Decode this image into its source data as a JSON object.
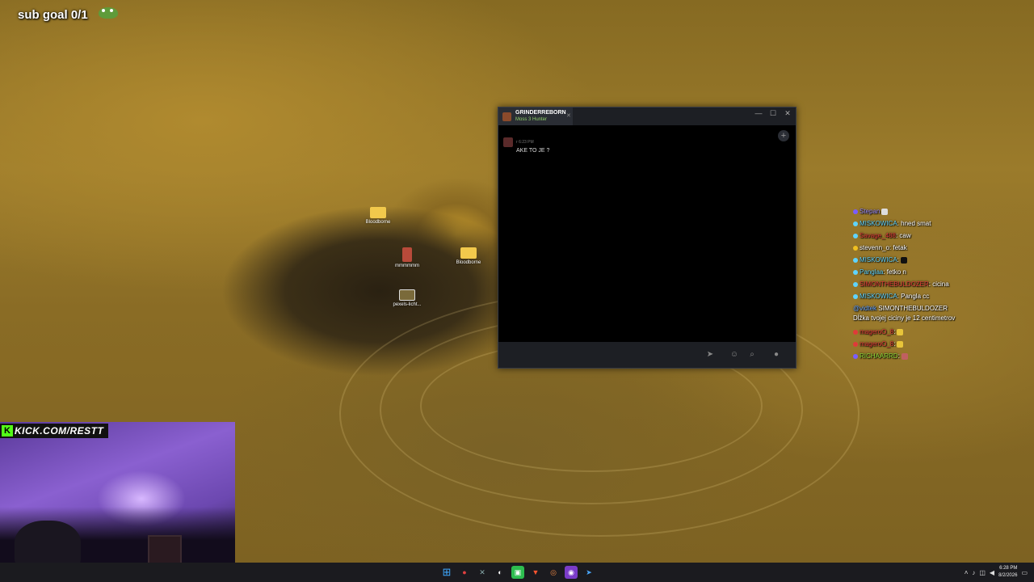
{
  "overlay": {
    "sub_goal": "sub goal 0/1",
    "kick_url": "KICK.COM/RESTT"
  },
  "desktop_icons": [
    {
      "label": "Bloodborne",
      "icon": "folder-icon"
    },
    {
      "label": "mmmmmm",
      "icon": "red-app-icon"
    },
    {
      "label": "Bloodborne",
      "icon": "folder-icon"
    },
    {
      "label": "pexels-licht...",
      "icon": "image-file-icon"
    }
  ],
  "chat_window": {
    "friend_name": "GRINDERREBORN",
    "friend_game": "Moss 3 Hunter",
    "message": {
      "author": "r",
      "time": "6:23 PM",
      "text": "AKE TO JE ?"
    }
  },
  "stream_chat": [
    {
      "user": "Stepan",
      "text": "",
      "color": "#9a8cff"
    },
    {
      "user": "MISKOWICA",
      "text": ": hned smat",
      "color": "#5fd4ff"
    },
    {
      "user": "Savage_488",
      "text": ": caw",
      "color": "#e03a3a"
    },
    {
      "user": "stevenn_o",
      "text": ": fetak",
      "color": "#ffffff"
    },
    {
      "user": "MISKOWICA",
      "text": ":",
      "color": "#5fd4ff"
    },
    {
      "user": "Panglaa",
      "text": ": fetko n",
      "color": "#5fd4ff"
    },
    {
      "user": "SIMONTHEBULDOZER",
      "text": ": cicina",
      "color": "#e03a3a"
    },
    {
      "user": "MISKOWICA",
      "text": ": Pangla cc",
      "color": "#5fd4ff"
    },
    {
      "user": "@vidtek",
      "text": " SIMONTHEBULDOZER",
      "color": "#5fa0ff"
    },
    {
      "user": "",
      "text": "Dĺžka tvojej ciciny je 12 centimetrov",
      "color": "#ffffff"
    },
    {
      "user": "mageroO_8",
      "text": ":",
      "color": "#e03a3a"
    },
    {
      "user": "mageroO_8",
      "text": ":",
      "color": "#e03a3a"
    },
    {
      "user": "RICHAARRD",
      "text": ":",
      "color": "#8fdc3a"
    }
  ],
  "taskbar": {
    "time": "6:28 PM",
    "date": "8/2/2026"
  },
  "colors": {
    "kick_green": "#53fc18",
    "taskbar_bg": "#1b1b1f"
  }
}
